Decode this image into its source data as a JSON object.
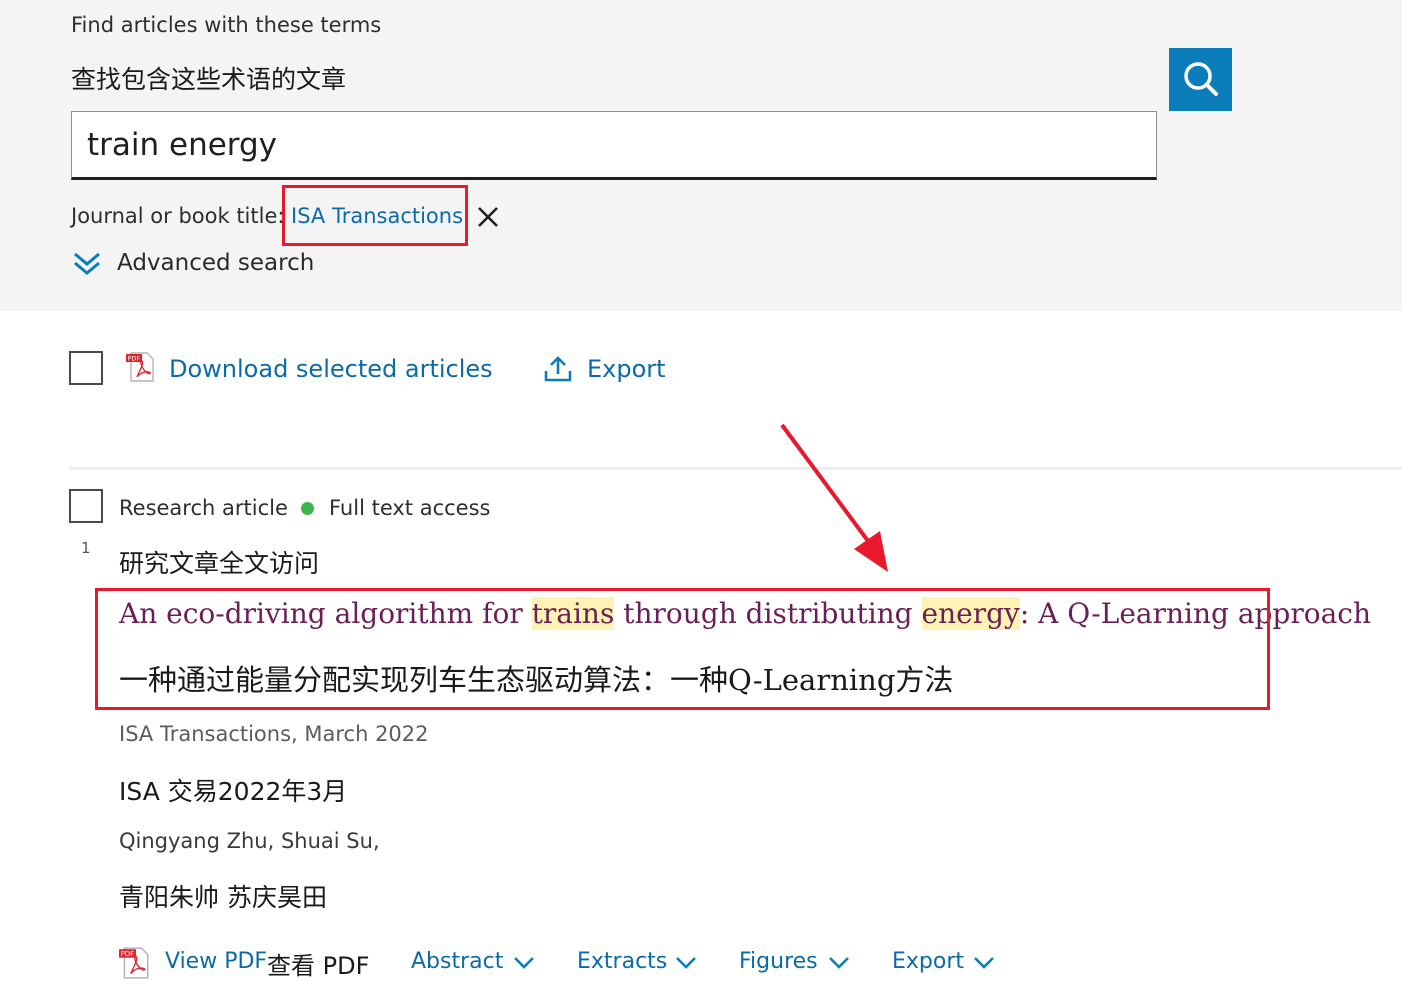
{
  "search": {
    "label": "Find articles with these terms",
    "label_zh": "查找包含这些术语的文章",
    "value": "train energy",
    "search_icon": "search-icon",
    "filter_label": "Journal or book title:",
    "filter_value": "ISA Transactions",
    "remove_icon": "close-icon",
    "advanced_label": "Advanced search",
    "advanced_icon": "double-chevron-down-icon"
  },
  "toolbar": {
    "download_label": "Download selected articles",
    "download_icon": "pdf-icon",
    "export_label": "Export",
    "export_icon": "upload-icon"
  },
  "result": {
    "number": "1",
    "type": "Research article",
    "access": "Full text access",
    "access_color": "#3cb64a",
    "type_zh": "研究文章全文访问",
    "title_parts": [
      "An eco-driving algorithm for ",
      "trains",
      " through distributing ",
      "energy",
      ": A Q-Learning approach"
    ],
    "title_zh": "一种通过能量分配实现列车生态驱动算法：一种Q-Learning方法",
    "source": "ISA Transactions, March 2022",
    "source_zh": "ISA 交易2022年3月",
    "authors": "Qingyang Zhu, Shuai Su,",
    "authors_zh": "青阳朱帅 苏庆昊田",
    "actions": {
      "view_pdf": "View PDF",
      "view_pdf_zh": "查看 PDF",
      "abstract": "Abstract",
      "extracts": "Extracts",
      "figures": "Figures",
      "export": "Export"
    }
  },
  "annotation": {
    "color": "#e8192c"
  }
}
